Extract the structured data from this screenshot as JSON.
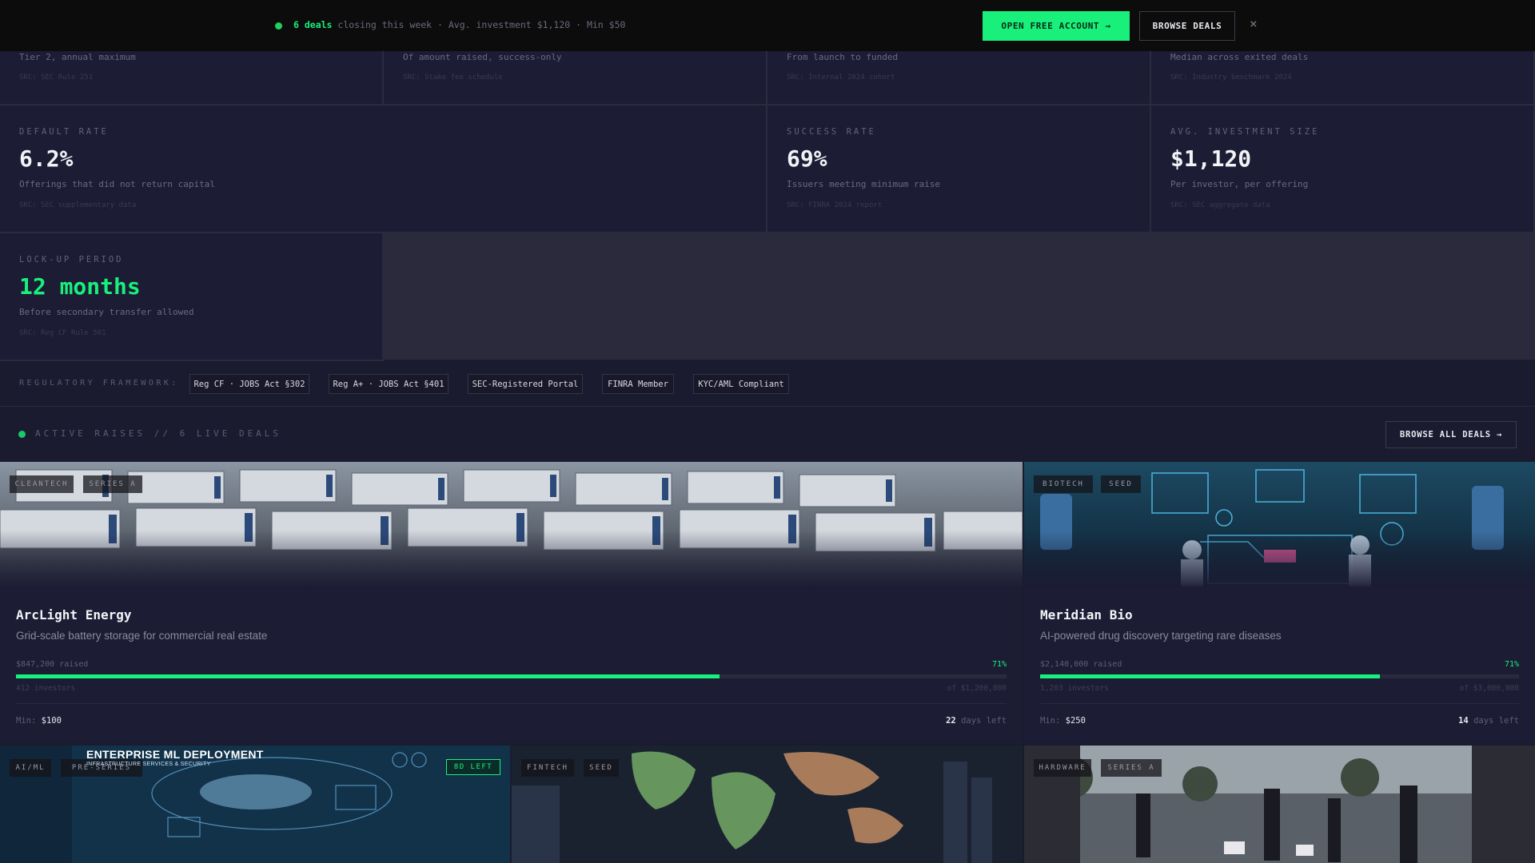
{
  "topbar": {
    "highlight": "6 deals",
    "message": " closing this week · Avg. investment $1,120 · Min $50",
    "open_account_label": "OPEN FREE ACCOUNT →",
    "browse_label": "BROWSE DEALS",
    "close_glyph": "×"
  },
  "stats_top_row": [
    {
      "desc": "Tier 2, annual maximum",
      "src": "SRC: SEC Rule 251"
    },
    {
      "desc": "Of amount raised, success-only",
      "src": "SRC: Stake fee schedule"
    },
    {
      "desc": "From launch to funded",
      "src": "SRC: Internal 2024 cohort"
    },
    {
      "desc": "Median across exited deals",
      "src": "SRC: Industry benchmark 2024"
    }
  ],
  "stats": [
    {
      "label": "DEFAULT RATE",
      "value": "6.2%",
      "desc": "Offerings that did not return capital",
      "src": "SRC: SEC supplementary data"
    },
    {
      "label": "SUCCESS RATE",
      "value": "69%",
      "desc": "Issuers meeting minimum raise",
      "src": "SRC: FINRA 2024 report"
    },
    {
      "label": "AVG. INVESTMENT SIZE",
      "value": "$1,120",
      "desc": "Per investor, per offering",
      "src": "SRC: SEC aggregate data"
    },
    {
      "label": "LOCK-UP PERIOD",
      "value": "12 months",
      "desc": "Before secondary transfer allowed",
      "src": "SRC: Reg CF Rule 501"
    }
  ],
  "regulatory": {
    "label": "REGULATORY FRAMEWORK:",
    "chips": [
      "Reg CF · JOBS Act §302",
      "Reg A+ · JOBS Act §401",
      "SEC-Registered Portal",
      "FINRA Member",
      "KYC/AML Compliant"
    ]
  },
  "active": {
    "title": "ACTIVE RAISES // 6 LIVE DEALS",
    "browse_all_label": "BROWSE ALL DEALS →"
  },
  "deals": [
    {
      "tags": [
        "CLEANTECH",
        "SERIES A"
      ],
      "name": "ArcLight Energy",
      "tagline": "Grid-scale battery storage for commercial real estate",
      "raised": "$847,200 raised",
      "percent_text": "71%",
      "progress": 0.71,
      "investors": "412 investors",
      "goal": "of $1,200,000",
      "min_label": "Min:",
      "min_value": "$100",
      "days_value": "22",
      "days_label": "days left"
    },
    {
      "tags": [
        "BIOTECH",
        "SEED"
      ],
      "name": "Meridian Bio",
      "tagline": "AI-powered drug discovery targeting rare diseases",
      "raised": "$2,140,000 raised",
      "percent_text": "71%",
      "progress": 0.71,
      "investors": "1,203 investors",
      "goal": "of $3,000,000",
      "min_label": "Min:",
      "min_value": "$250",
      "days_value": "14",
      "days_label": "days left"
    }
  ],
  "thumbs": [
    {
      "tags": [
        "AI/ML",
        "PRE-SERIES"
      ],
      "overlay_title": "ENTERPRISE ML DEPLOYMENT",
      "overlay_sub": "INFRASTRUCTURE SERVICES & SECURITY",
      "badge": "8D LEFT"
    },
    {
      "tags": [
        "FINTECH",
        "SEED"
      ]
    },
    {
      "tags": [
        "HARDWARE",
        "SERIES A"
      ]
    }
  ],
  "colors": {
    "accent": "#19f07c",
    "background": "#1b1b2e",
    "card": "#1c1c34"
  }
}
